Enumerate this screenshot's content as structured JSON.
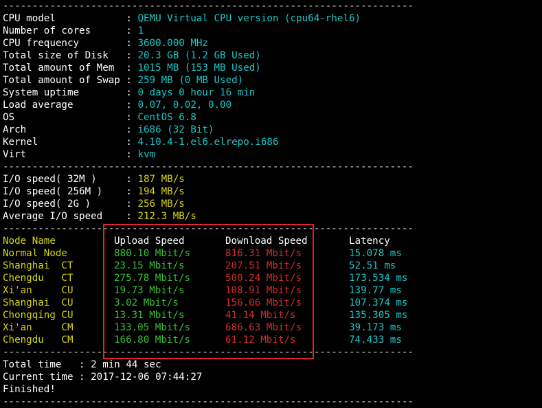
{
  "separator": "----------------------------------------------------------------------",
  "sysinfo": [
    {
      "label": "CPU model            ",
      "value": "QEMU Virtual CPU version (cpu64-rhel6)"
    },
    {
      "label": "Number of cores      ",
      "value": "1"
    },
    {
      "label": "CPU frequency        ",
      "value": "3600.000 MHz"
    },
    {
      "label": "Total size of Disk   ",
      "value": "20.3 GB (1.2 GB Used)"
    },
    {
      "label": "Total amount of Mem  ",
      "value": "1015 MB (153 MB Used)"
    },
    {
      "label": "Total amount of Swap ",
      "value": "259 MB (0 MB Used)"
    },
    {
      "label": "System uptime        ",
      "value": "0 days 0 hour 16 min"
    },
    {
      "label": "Load average         ",
      "value": "0.07, 0.02, 0.00"
    },
    {
      "label": "OS                   ",
      "value": "CentOS 6.8"
    },
    {
      "label": "Arch                 ",
      "value": "i686 (32 Bit)"
    },
    {
      "label": "Kernel               ",
      "value": "4.10.4-1.el6.elrepo.i686"
    },
    {
      "label": "Virt                 ",
      "value": "kvm"
    }
  ],
  "io": [
    {
      "label": "I/O speed( 32M )     ",
      "value": "187 MB/s"
    },
    {
      "label": "I/O speed( 256M )    ",
      "value": "194 MB/s"
    },
    {
      "label": "I/O speed( 2G )      ",
      "value": "256 MB/s"
    },
    {
      "label": "Average I/O speed    ",
      "value": "212.3 MB/s"
    }
  ],
  "speedtest": {
    "headers": {
      "node": "Node Name",
      "upload": "Upload Speed",
      "download": "Download Speed",
      "latency": "Latency"
    },
    "rows": [
      {
        "node": "Normal Node",
        "upload": "880.10 Mbit/s",
        "download": "816.31 Mbit/s",
        "latency": "15.078 ms"
      },
      {
        "node": "Shanghai  CT",
        "upload": "23.15 Mbit/s",
        "download": "207.51 Mbit/s",
        "latency": "52.51 ms"
      },
      {
        "node": "Chengdu   CT",
        "upload": "275.78 Mbit/s",
        "download": "500.24 Mbit/s",
        "latency": "173.534 ms"
      },
      {
        "node": "Xi'an     CU",
        "upload": "19.73 Mbit/s",
        "download": "108.91 Mbit/s",
        "latency": "139.77 ms"
      },
      {
        "node": "Shanghai  CU",
        "upload": "3.02 Mbit/s",
        "download": "156.06 Mbit/s",
        "latency": "107.374 ms"
      },
      {
        "node": "Chongqing CU",
        "upload": "13.31 Mbit/s",
        "download": "41.14 Mbit/s",
        "latency": "135.305 ms"
      },
      {
        "node": "Xi'an     CM",
        "upload": "133.05 Mbit/s",
        "download": "686.63 Mbit/s",
        "latency": "39.173 ms"
      },
      {
        "node": "Chengdu   CM",
        "upload": "166.80 Mbit/s",
        "download": "61.12 Mbit/s",
        "latency": "74.433 ms"
      }
    ]
  },
  "footer": {
    "total_time_label": "Total time   : ",
    "total_time": "2 min 44 sec",
    "current_time_label": "Current time : ",
    "current_time": "2017-12-06 07:44:27",
    "finished": "Finished!"
  },
  "colors": {
    "label": "#ffffff",
    "info_value": "#19c7c7",
    "io_value": "#d6d60c",
    "node_name": "#d6d60c",
    "upload": "#35c035",
    "download": "#d62a2a",
    "latency": "#19c7c7",
    "highlight_box": "#e0252b"
  }
}
